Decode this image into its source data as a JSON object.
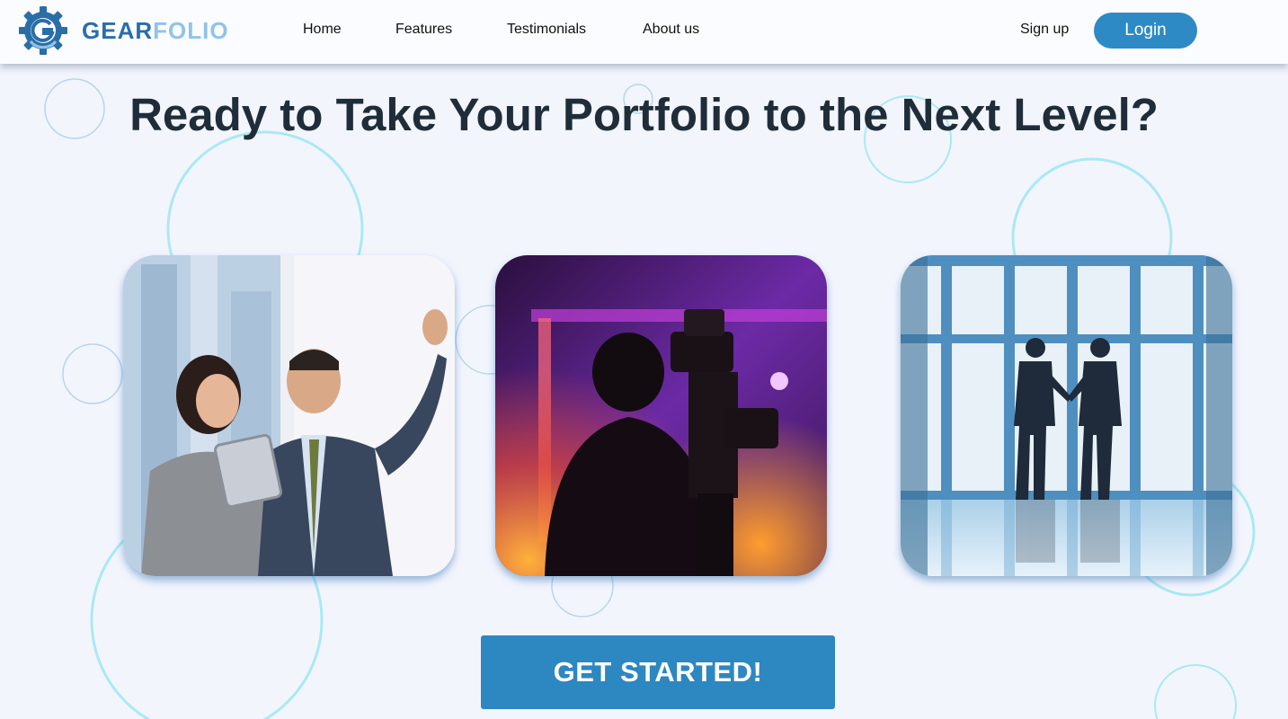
{
  "brand": {
    "name_part1": "GEAR",
    "name_part2": "FOLIO",
    "logo_icon": "gear-g-icon",
    "colors": {
      "primary": "#2a6ea8",
      "secondary": "#8fc3ea"
    }
  },
  "nav": {
    "items": [
      {
        "label": "Home"
      },
      {
        "label": "Features"
      },
      {
        "label": "Testimonials"
      },
      {
        "label": "About us"
      }
    ],
    "signup_label": "Sign up",
    "login_label": "Login"
  },
  "hero": {
    "headline": "Ready to Take Your Portfolio to the Next Level?"
  },
  "images": [
    {
      "name": "celebrating-business-people-photo"
    },
    {
      "name": "camera-operator-photo"
    },
    {
      "name": "handshake-silhouette-photo"
    }
  ],
  "cta": {
    "label": "GET STARTED!"
  },
  "colors": {
    "accent": "#2d8ac5",
    "background": "#f3f5fd",
    "heading": "#1f2d3a",
    "decorative_circle": "#9be6f3"
  }
}
